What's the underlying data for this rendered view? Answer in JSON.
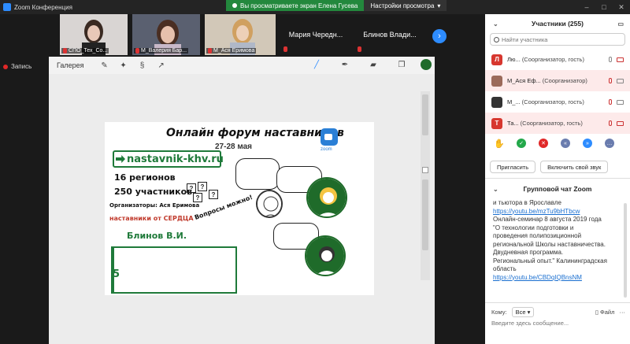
{
  "window": {
    "title": "Zoom Конференция",
    "controls": [
      "–",
      "□",
      "✕"
    ]
  },
  "share_banner": {
    "message": "Вы просматриваете экран Елена Гусева",
    "options_label": "Настройки просмотра"
  },
  "gallery": {
    "tiles": [
      {
        "name": "СПО_Тех_Со...",
        "muted": true
      },
      {
        "name": "М_Валерия Бар...",
        "muted": true
      },
      {
        "name": "М_Ася Еримова",
        "muted": true
      },
      {
        "name": "Мария Чередн...",
        "muted": true
      },
      {
        "name": "Блинов Влади...",
        "muted": true
      }
    ],
    "next_icon": "chevron-right-icon"
  },
  "recording": {
    "label": "Запись"
  },
  "whiteboard_toolbar": {
    "gallery_label": "Галерея",
    "tools": [
      "wrench-icon",
      "magic-wand-icon",
      "curve-icon",
      "arrow-icon"
    ],
    "right_tools": [
      "pen-icon",
      "marker-icon",
      "eraser-icon",
      "layers-icon"
    ],
    "active_color": "#1f6b2a"
  },
  "slide": {
    "title": "Онлайн форум наставников",
    "dates": "27-28 мая",
    "zoom_label": "zoom",
    "url": "nastavnik-khv.ru",
    "lines": [
      "16 регионов",
      "250 участников",
      "Организаторы: Ася Еримова",
      "наставники от СЕРДЦА",
      "Блинов В.И.",
      "Вопросы можно!"
    ]
  },
  "participants_panel": {
    "title": "Участники (255)",
    "search_placeholder": "Найти участника",
    "participants": [
      {
        "initial": "Л",
        "color": "#d7372f",
        "name": "Лю...",
        "role": "(Соорганизатор, гость)"
      },
      {
        "initial": "",
        "color": "#9b6a5a",
        "name": "М_Ася Еф...",
        "role": "(Соорганизатор)"
      },
      {
        "initial": "",
        "color": "#333333",
        "name": "М_...",
        "role": "(Соорганизатор, гость)"
      },
      {
        "initial": "Т",
        "color": "#d7372f",
        "name": "Та...",
        "role": "(Соорганизатор, гость)"
      }
    ],
    "reactions": [
      {
        "icon": "raise-hand-icon",
        "color": "#2D8CFF"
      },
      {
        "icon": "yes-icon",
        "color": "#23a84a"
      },
      {
        "icon": "no-icon",
        "color": "#e02828"
      },
      {
        "icon": "slower-icon",
        "color": "#6a7cae"
      },
      {
        "icon": "faster-icon",
        "color": "#2D8CFF"
      },
      {
        "icon": "more-icon",
        "color": "#6a7cae"
      }
    ],
    "invite_label": "Пригласить",
    "unmute_label": "Включить свой звук"
  },
  "chat": {
    "title": "Групповой чат Zoom",
    "lines": [
      {
        "text": "и тьютора в Ярославле",
        "link": false
      },
      {
        "text": "https://youtu.be/mzTu9bHTbcw",
        "link": true
      },
      {
        "text": "Онлайн-семинар 8 августа 2019 года",
        "link": false
      },
      {
        "text": "\"О технологии подготовки и",
        "link": false
      },
      {
        "text": "проведения полипозиционной",
        "link": false
      },
      {
        "text": "региональной Школы наставничества.",
        "link": false
      },
      {
        "text": "Двудневная программа.",
        "link": false
      },
      {
        "text": "Региональный опыт.\" Калининградская",
        "link": false
      },
      {
        "text": "область",
        "link": false
      },
      {
        "text": "https://youtu.be/CBDqIQBnsNM",
        "link": true
      }
    ],
    "to_label": "Кому:",
    "to_value": "Все",
    "file_label": "Файл",
    "input_placeholder": "Введите здесь сообщение..."
  }
}
